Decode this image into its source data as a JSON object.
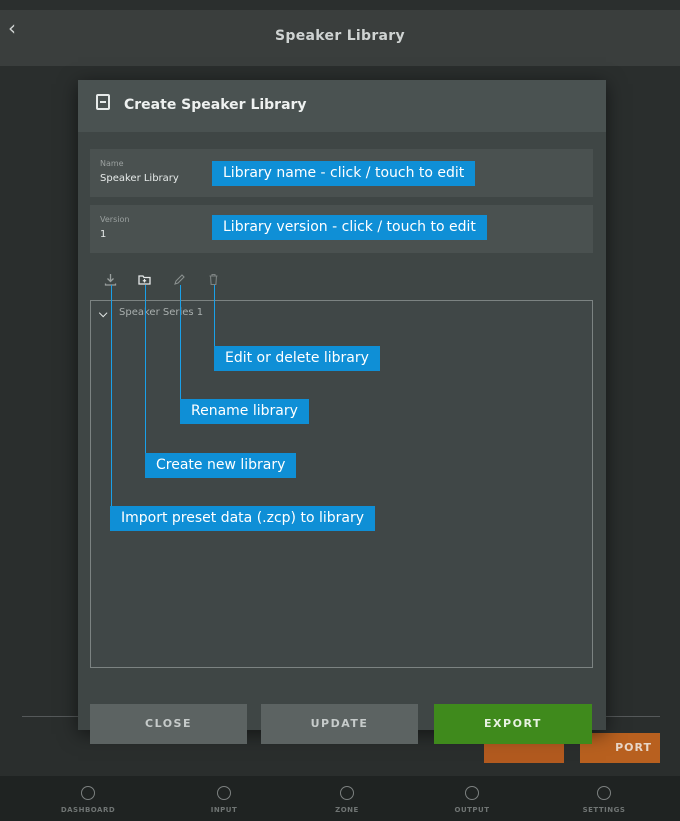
{
  "app": {
    "title": "Speaker Library",
    "back_icon": "chevron-left-icon"
  },
  "background": {
    "right_button_label": "PORT"
  },
  "bottom_nav": {
    "items": [
      {
        "label": "DASHBOARD",
        "icon": "dashboard-icon"
      },
      {
        "label": "INPUT",
        "icon": "input-icon"
      },
      {
        "label": "ZONE",
        "icon": "zone-icon"
      },
      {
        "label": "OUTPUT",
        "icon": "output-icon"
      },
      {
        "label": "SETTINGS",
        "icon": "settings-icon"
      }
    ]
  },
  "modal": {
    "title": "Create Speaker Library",
    "name_field": {
      "label": "Name",
      "value": "Speaker Library"
    },
    "version_field": {
      "label": "Version",
      "value": "1"
    },
    "toolbar": {
      "import_icon": "download-icon",
      "create_icon": "new-folder-icon",
      "rename_icon": "pencil-icon",
      "delete_icon": "trash-icon"
    },
    "tree": {
      "items": [
        {
          "label": "Speaker Series 1",
          "expanded": true
        }
      ]
    },
    "buttons": {
      "close": "CLOSE",
      "update": "UPDATE",
      "export": "EXPORT"
    }
  },
  "callouts": {
    "library_name": "Library name - click / touch to edit",
    "library_version": "Library version - click / touch to edit",
    "edit_delete": "Edit or delete library",
    "rename": "Rename library",
    "create_new": "Create new library",
    "import": "Import preset data (.zcp) to library"
  },
  "colors": {
    "accent_callout": "#0f8fd6",
    "export_green": "#3f8a1c",
    "orange": "#b8601f"
  }
}
